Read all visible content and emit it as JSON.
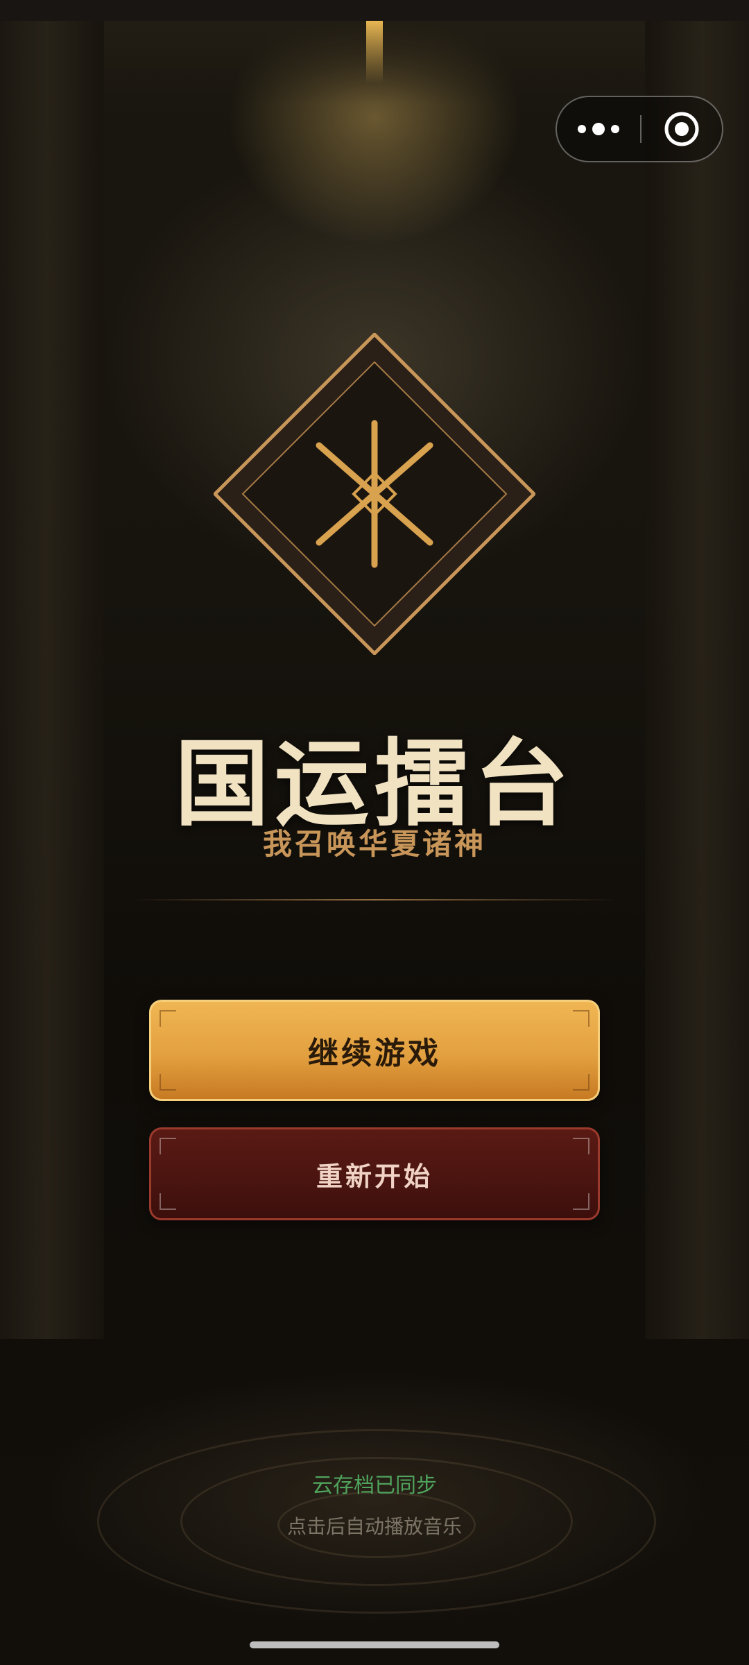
{
  "header": {
    "more_icon": "more-dots-icon",
    "close_icon": "target-circle-icon"
  },
  "game": {
    "title": "国运擂台",
    "subtitle": "我召唤华夏诸神"
  },
  "menu": {
    "continue_label": "继续游戏",
    "restart_label": "重新开始"
  },
  "footer": {
    "cloud_status": "云存档已同步",
    "music_hint": "点击后自动播放音乐"
  },
  "colors": {
    "accent_gold": "#e3a040",
    "danger_red": "#4a1410",
    "title_cream": "#f1e2c2",
    "status_green": "#4fa35c"
  }
}
